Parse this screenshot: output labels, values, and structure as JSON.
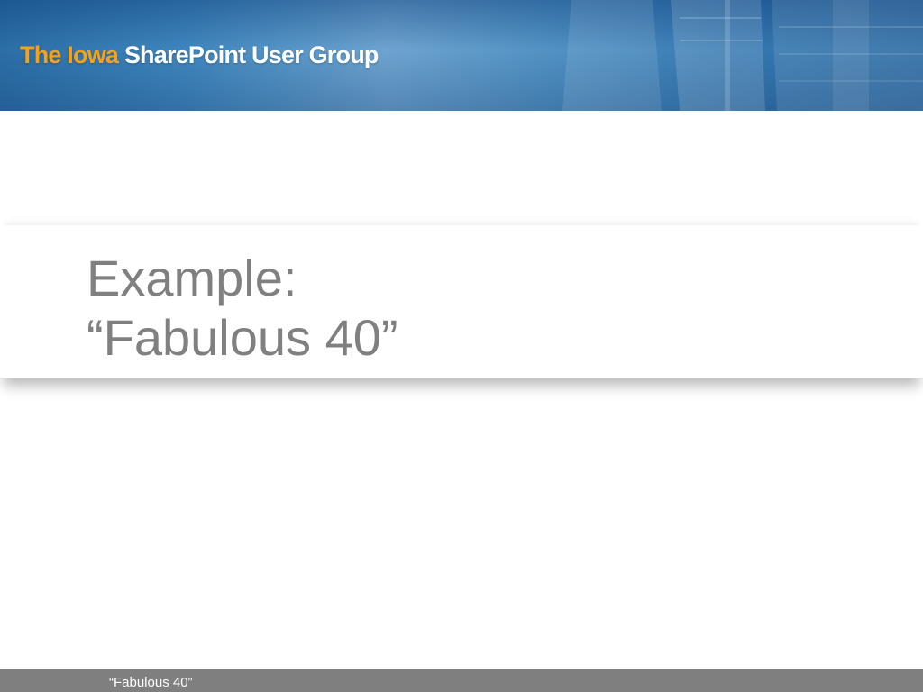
{
  "header": {
    "logo_highlight": "The Iowa",
    "logo_rest": "SharePoint User Group",
    "colors": {
      "banner": "#3f86be",
      "logo_highlight": "#f5a21a",
      "logo_rest": "#ffffff"
    }
  },
  "slide": {
    "title_line1": "Example:",
    "title_line2": "“Fabulous 40”",
    "title_color": "#808080"
  },
  "footer": {
    "text": "“Fabulous 40”",
    "background": "#7f7f7f"
  }
}
